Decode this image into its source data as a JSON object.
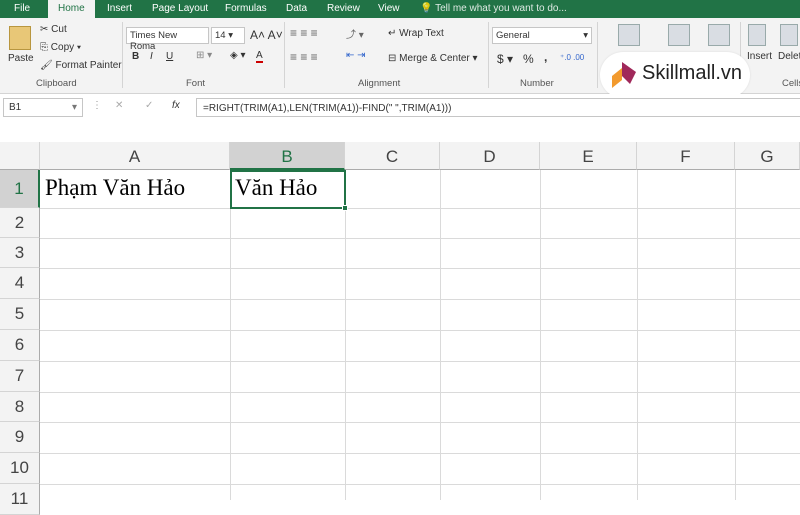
{
  "tabs": [
    "File",
    "Home",
    "Insert",
    "Page Layout",
    "Formulas",
    "Data",
    "Review",
    "View"
  ],
  "tell_me": "Tell me what you want to do...",
  "clipboard": {
    "paste": "Paste",
    "cut": "Cut",
    "copy": "Copy",
    "format_painter": "Format Painter",
    "label": "Clipboard"
  },
  "font": {
    "name": "Times New Roma",
    "size": "14",
    "label": "Font",
    "bold": "B",
    "italic": "I",
    "underline": "U"
  },
  "alignment": {
    "wrap": "Wrap Text",
    "merge": "Merge & Center",
    "label": "Alignment"
  },
  "number": {
    "format": "General",
    "currency": "$",
    "percent": "%",
    "comma": ",",
    "label": "Number"
  },
  "cells": {
    "insert": "Insert",
    "delete": "Delete",
    "label": "Cells"
  },
  "watermark": "Skillmall.vn",
  "name_box": "B1",
  "formula": "=RIGHT(TRIM(A1),LEN(TRIM(A1))-FIND(\" \",TRIM(A1)))",
  "fx": "fx",
  "columns": [
    "A",
    "B",
    "C",
    "D",
    "E",
    "F",
    "G"
  ],
  "rows": [
    "1",
    "2",
    "3",
    "4",
    "5",
    "6",
    "7",
    "8",
    "9",
    "10",
    "11"
  ],
  "cells_data": {
    "A1": "Phạm Văn Hảo",
    "B1": "Văn Hảo"
  },
  "colors": {
    "accent": "#217346"
  }
}
